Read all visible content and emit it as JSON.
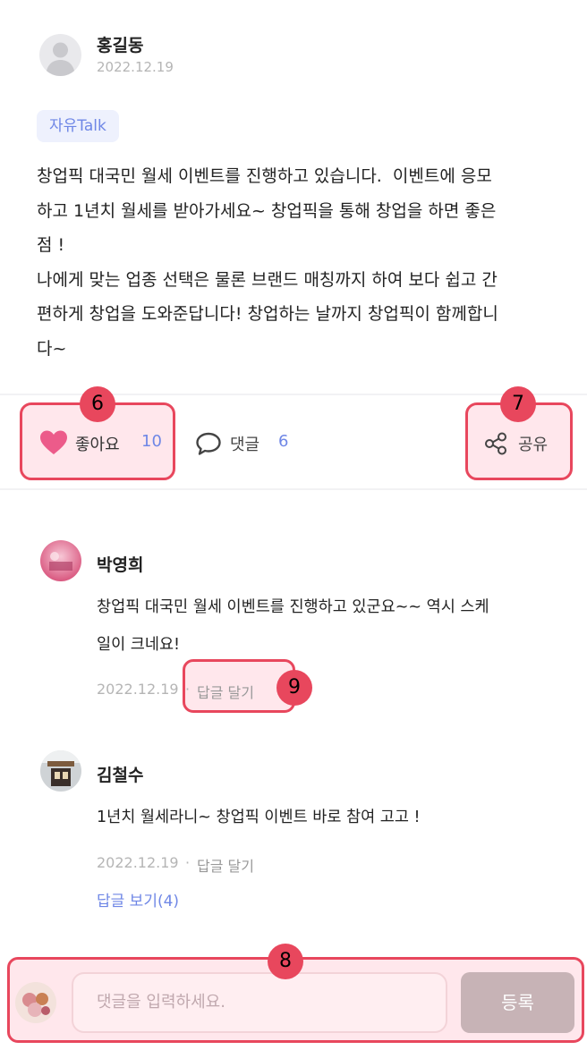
{
  "post": {
    "author": "홍길동",
    "date": "2022.12.19",
    "tag": "자유Talk",
    "body": "창업픽 대국민 월세 이벤트를 진행하고 있습니다.  이벤트에 응모\n하고 1년치 월세를 받아가세요~ 창업픽을 통해 창업을 하면 좋은\n점 !\n나에게 맞는 업종 선택은 물론 브랜드 매칭까지 하여 보다 쉽고 간\n편하게 창업을 도와준답니다! 창업하는 날까지 창업픽이 함께합니\n다~"
  },
  "actions": {
    "like_label": "좋아요",
    "like_count": "10",
    "comment_label": "댓글",
    "comment_count": "6",
    "share_label": "공유"
  },
  "markers": {
    "like": "6",
    "share": "7",
    "input": "8",
    "reply": "9"
  },
  "comments": [
    {
      "author": "박영희",
      "text": "창업픽 대국민 월세 이벤트를 진행하고 있군요~~ 역시 스케\n일이 크네요!",
      "date": "2022.12.19",
      "separator": "·",
      "reply_label": "답글 달기"
    },
    {
      "author": "김철수",
      "text": "1년치 월세라니~ 창업픽 이벤트 바로 참여 고고 !",
      "date": "2022.12.19",
      "separator": "·",
      "reply_label": "답글 달기",
      "view_replies": "답글 보기(4)"
    }
  ],
  "comment_input": {
    "placeholder": "댓글을 입력하세요.",
    "submit_label": "등록"
  },
  "colors": {
    "accent_pink": "#e8475d",
    "highlight_fill": "#ffe7ec",
    "link_blue": "#6f87e6",
    "heart": "#ec5b8a"
  },
  "icons": {
    "like": "heart-icon",
    "comment": "speech-bubble-icon",
    "share": "share-icon"
  }
}
